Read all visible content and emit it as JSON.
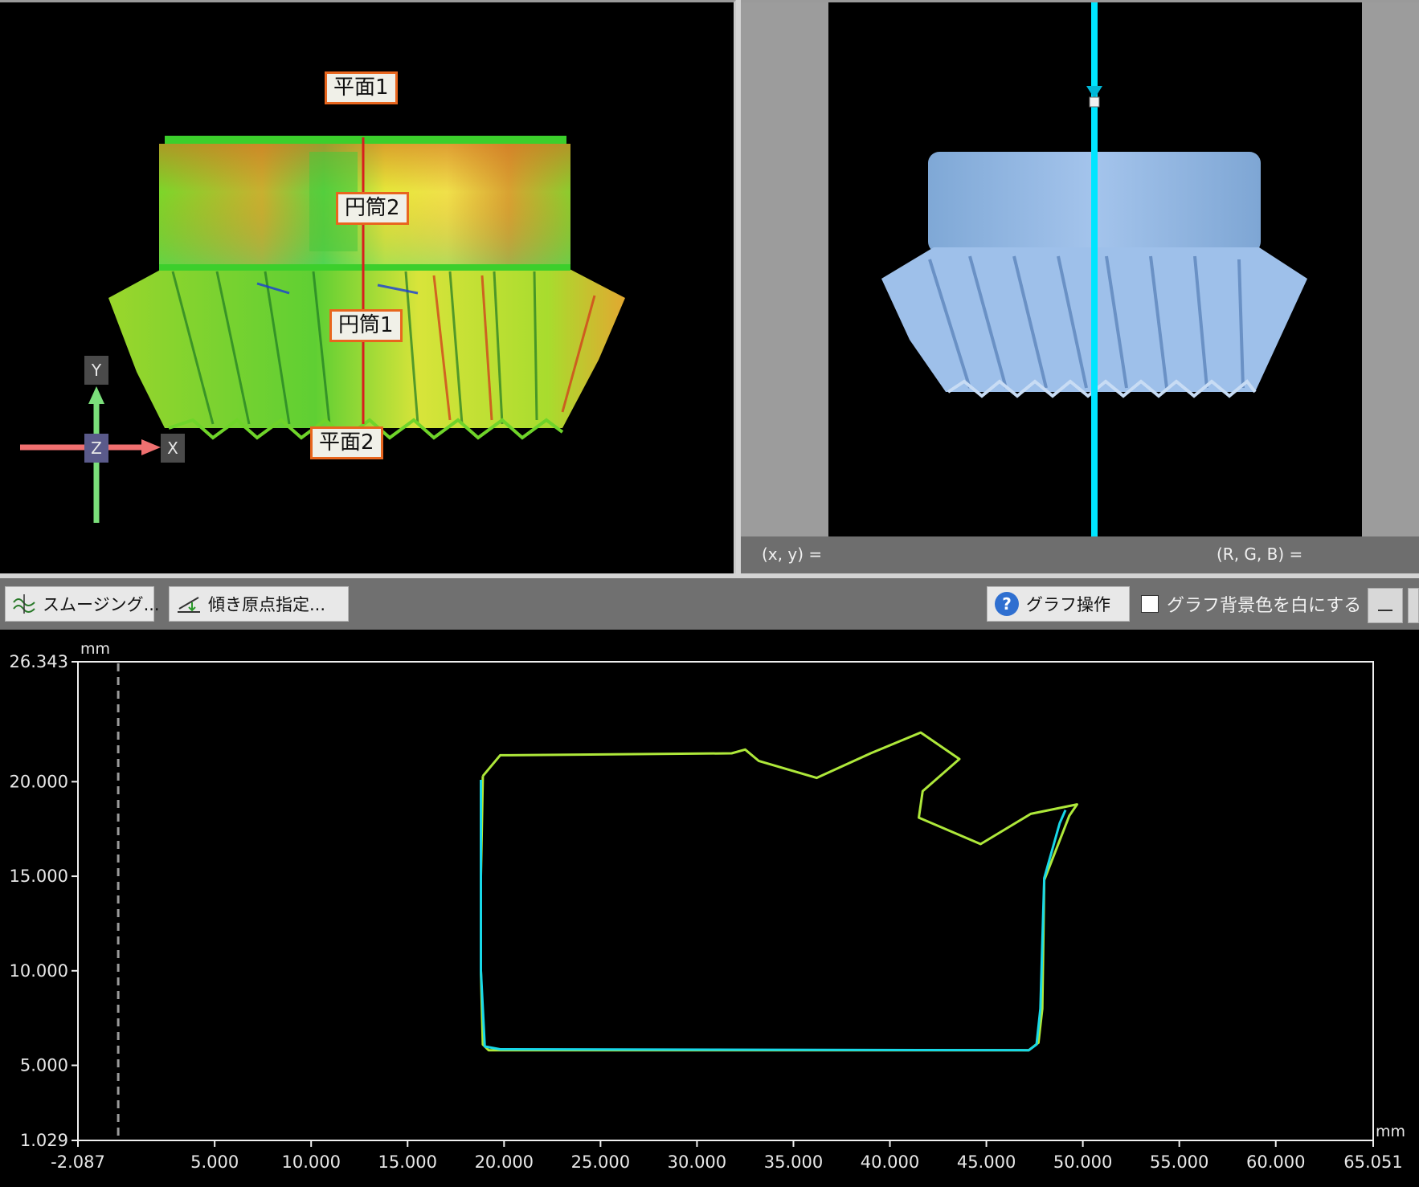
{
  "view3d": {
    "labels": {
      "plane1": "平面1",
      "cylinder2": "円筒2",
      "cylinder1": "円筒1",
      "plane2": "平面2"
    },
    "axes": {
      "y": "Y",
      "z": "Z",
      "x": "X"
    }
  },
  "image_view": {
    "coord_label": "(x, y)  =",
    "rgb_label": "(R, G, B)  ="
  },
  "toolbar": {
    "smoothing": "スムージング...",
    "tilt_origin": "傾き原点指定...",
    "graph_ops": "グラフ操作",
    "white_bg": "グラフ背景色を白にする"
  },
  "colors": {
    "profile_green": "#aee83a",
    "profile_cyan": "#18d8e8",
    "label_border": "#e8661e",
    "section_line": "#00e5ff",
    "gear_blue": "#8fb8e6"
  },
  "chart_data": {
    "type": "line",
    "x_unit": "mm",
    "y_unit": "mm",
    "xlim": [
      -2.087,
      65.051
    ],
    "ylim": [
      1.029,
      26.343
    ],
    "x_ticks": [
      "-2.087",
      "5.000",
      "10.000",
      "15.000",
      "20.000",
      "25.000",
      "30.000",
      "35.000",
      "40.000",
      "45.000",
      "50.000",
      "55.000",
      "60.000",
      "65.051"
    ],
    "y_ticks": [
      "26.343",
      "20.000",
      "15.000",
      "10.000",
      "5.000",
      "1.029"
    ],
    "reference_x": 0.0,
    "series": [
      {
        "color": "#aee83a",
        "x": [
          18.9,
          18.8,
          18.8,
          18.9,
          19.2,
          47.2,
          47.7,
          47.9,
          48.0,
          49.3,
          49.7,
          47.3,
          44.7,
          41.5,
          41.7,
          43.6,
          41.6,
          39.0,
          36.2,
          33.2,
          32.5,
          31.8,
          20.3,
          19.8,
          18.9
        ],
        "y": [
          20.3,
          15.0,
          10.0,
          6.1,
          5.8,
          5.8,
          6.2,
          8.0,
          14.8,
          18.2,
          18.8,
          18.3,
          16.7,
          18.1,
          19.5,
          21.2,
          22.6,
          21.5,
          20.2,
          21.1,
          21.7,
          21.5,
          21.4,
          21.4,
          20.3
        ]
      },
      {
        "color": "#18d8e8",
        "x": [
          18.8,
          18.8,
          19.0,
          19.8,
          47.2,
          47.6,
          47.8,
          48.0,
          48.8,
          49.1
        ],
        "y": [
          20.1,
          10.0,
          6.0,
          5.85,
          5.8,
          6.1,
          8.0,
          14.9,
          17.8,
          18.5
        ]
      }
    ]
  }
}
